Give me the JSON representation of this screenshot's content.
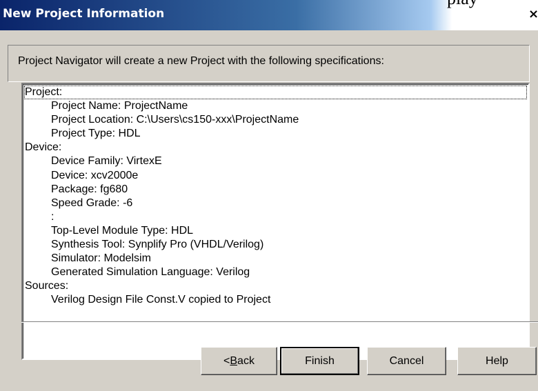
{
  "background_text": "play",
  "window": {
    "title": "New Project Information",
    "close_icon": "×"
  },
  "header": {
    "text": "Project Navigator will create a new Project with the following specifications:"
  },
  "summary": [
    {
      "text": "Project:",
      "indent": false
    },
    {
      "text": "Project Name: ProjectName",
      "indent": true
    },
    {
      "text": "Project Location: C:\\Users\\cs150-xxx\\ProjectName",
      "indent": true
    },
    {
      "text": "Project Type: HDL",
      "indent": true
    },
    {
      "text": "Device:",
      "indent": false
    },
    {
      "text": "Device Family: VirtexE",
      "indent": true
    },
    {
      "text": "Device: xcv2000e",
      "indent": true
    },
    {
      "text": "Package: fg680",
      "indent": true
    },
    {
      "text": "Speed Grade: -6",
      "indent": true
    },
    {
      "text": ":",
      "indent": true
    },
    {
      "text": "Top-Level Module Type: HDL",
      "indent": true
    },
    {
      "text": "Synthesis Tool: Synplify Pro (VHDL/Verilog)",
      "indent": true
    },
    {
      "text": "Simulator: Modelsim",
      "indent": true
    },
    {
      "text": "Generated Simulation Language: Verilog",
      "indent": true
    },
    {
      "text": "Sources:",
      "indent": false
    },
    {
      "text": "Verilog Design File Const.V copied to Project",
      "indent": true
    }
  ],
  "buttons": {
    "back": {
      "prefix": "< ",
      "mnemonic": "B",
      "rest": "ack"
    },
    "finish": "Finish",
    "cancel": "Cancel",
    "help": "Help"
  }
}
